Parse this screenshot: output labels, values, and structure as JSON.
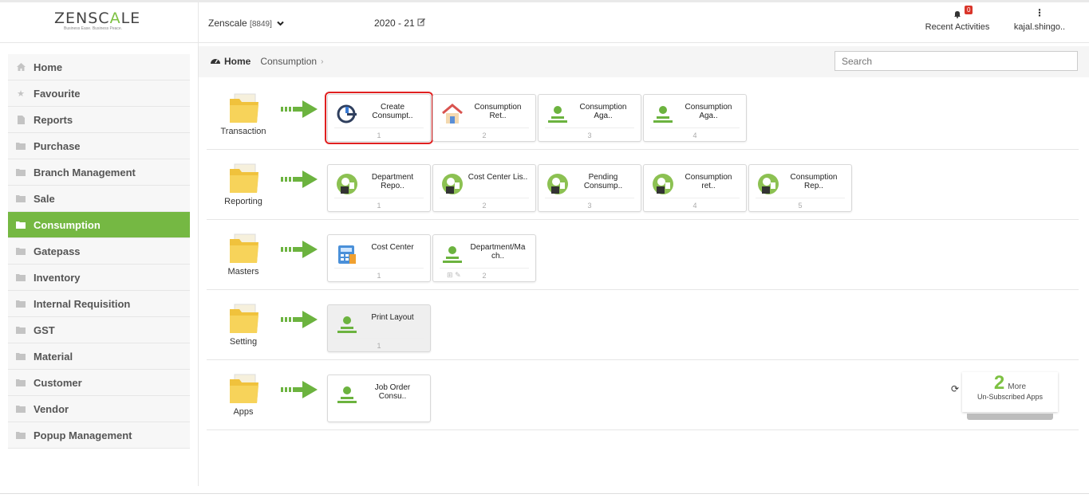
{
  "header": {
    "logo_text_a": "ZENSC",
    "logo_text_b": "A",
    "logo_text_c": "LE",
    "tagline": "Business Ease. Business Peace.",
    "company_name": "Zenscale",
    "company_code": "[8849]",
    "financial_year": "2020 - 21",
    "notifications_count": "0",
    "recent_label": "Recent Activities",
    "user_name": "kajal.shingo.."
  },
  "sidebar": {
    "items": [
      {
        "label": "Home",
        "icon": "home-icon"
      },
      {
        "label": "Favourite",
        "icon": "star-icon"
      },
      {
        "label": "Reports",
        "icon": "file-icon"
      },
      {
        "label": "Purchase",
        "icon": "folder-icon"
      },
      {
        "label": "Branch Management",
        "icon": "folder-icon"
      },
      {
        "label": "Sale",
        "icon": "folder-icon"
      },
      {
        "label": "Consumption",
        "icon": "folder-icon",
        "active": true
      },
      {
        "label": "Gatepass",
        "icon": "folder-icon"
      },
      {
        "label": "Inventory",
        "icon": "folder-icon"
      },
      {
        "label": "Internal Requisition",
        "icon": "folder-icon"
      },
      {
        "label": "GST",
        "icon": "folder-icon"
      },
      {
        "label": "Material",
        "icon": "folder-icon"
      },
      {
        "label": "Customer",
        "icon": "folder-icon"
      },
      {
        "label": "Vendor",
        "icon": "folder-icon"
      },
      {
        "label": "Popup Management",
        "icon": "folder-icon"
      }
    ]
  },
  "breadcrumb": {
    "home": "Home",
    "current": "Consumption"
  },
  "search": {
    "placeholder": "Search"
  },
  "sections": {
    "transaction": {
      "label": "Transaction",
      "tiles": [
        {
          "name": "Create Consumpt..",
          "num": "1"
        },
        {
          "name": "Consumption Ret..",
          "num": "2"
        },
        {
          "name": "Consumption Aga..",
          "num": "3"
        },
        {
          "name": "Consumption Aga..",
          "num": "4"
        }
      ]
    },
    "reporting": {
      "label": "Reporting",
      "tiles": [
        {
          "name": "Department Repo..",
          "num": "1"
        },
        {
          "name": "Cost Center Lis..",
          "num": "2"
        },
        {
          "name": "Pending Consump..",
          "num": "3"
        },
        {
          "name": "Consumption ret..",
          "num": "4"
        },
        {
          "name": "Consumption Rep..",
          "num": "5"
        }
      ]
    },
    "masters": {
      "label": "Masters",
      "tiles": [
        {
          "name": "Cost Center",
          "num": "1"
        },
        {
          "name": "Department/Ma ch..",
          "num": "2"
        }
      ]
    },
    "setting": {
      "label": "Setting",
      "tiles": [
        {
          "name": "Print Layout",
          "num": "1"
        }
      ]
    },
    "apps": {
      "label": "Apps",
      "tiles": [
        {
          "name": "Job Order Consu.."
        }
      ]
    }
  },
  "more_apps": {
    "count": "2",
    "word": "More",
    "subtitle": "Un-Subscribed Apps"
  },
  "colors": {
    "accent": "#75b843",
    "selected_outline": "#e02020",
    "badge": "#d9352a"
  }
}
